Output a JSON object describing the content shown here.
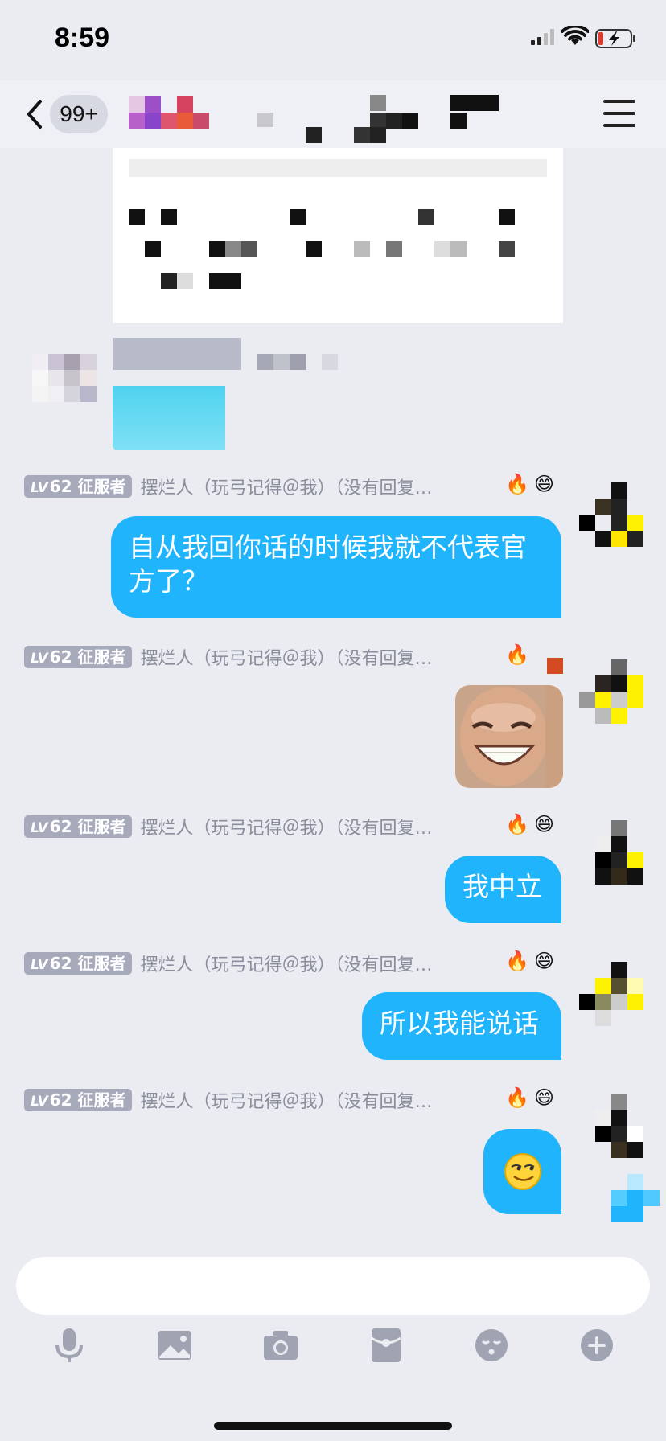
{
  "status_bar": {
    "time": "8:59"
  },
  "nav": {
    "unread_badge": "99+"
  },
  "messages": [
    {
      "level_prefix": "LV",
      "level_number": "62",
      "level_title": "征服者",
      "sender": "摆烂人（玩弓记得＠我）（没有回复…",
      "text": "自从我回你话的时候我就不代表官方了？"
    },
    {
      "level_prefix": "LV",
      "level_number": "62",
      "level_title": "征服者",
      "sender": "摆烂人（玩弓记得＠我）（没有回复…",
      "text": ""
    },
    {
      "level_prefix": "LV",
      "level_number": "62",
      "level_title": "征服者",
      "sender": "摆烂人（玩弓记得＠我）（没有回复…",
      "text": "我中立"
    },
    {
      "level_prefix": "LV",
      "level_number": "62",
      "level_title": "征服者",
      "sender": "摆烂人（玩弓记得＠我）（没有回复…",
      "text": "所以我能说话"
    },
    {
      "level_prefix": "LV",
      "level_number": "62",
      "level_title": "征服者",
      "sender": "摆烂人（玩弓记得＠我）（没有回复…",
      "text": ""
    }
  ],
  "input": {
    "value": "",
    "placeholder": ""
  },
  "toolbar_icons": [
    "microphone-icon",
    "image-icon",
    "camera-icon",
    "red-packet-icon",
    "emoji-icon",
    "plus-icon"
  ],
  "colors": {
    "bubble": "#1fb4fb",
    "background": "#eaecf2",
    "level_tag": "#a6aabb",
    "sender_text": "#8a8e9c",
    "icon": "#9fa3b2"
  }
}
